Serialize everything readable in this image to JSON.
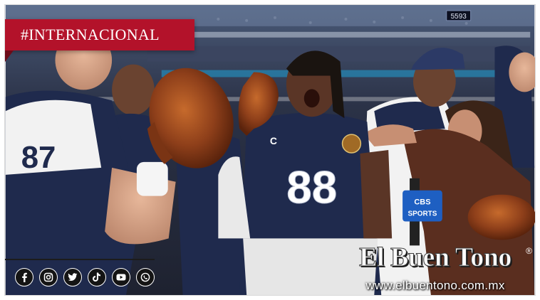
{
  "tag": {
    "label": "#INTERNACIONAL"
  },
  "scene": {
    "jersey_number_left": "87",
    "jersey_number_center": "88",
    "patch_letter": "C",
    "mic_flag_line1": "CBS",
    "mic_flag_line2": "SPORTS",
    "scoreboard_number": "5593"
  },
  "social": {
    "icons": [
      "facebook-icon",
      "instagram-icon",
      "twitter-icon",
      "tiktok-icon",
      "youtube-icon",
      "whatsapp-icon"
    ]
  },
  "brand": {
    "logo_text": "El Buen Tono",
    "registered_mark": "®",
    "url": "www.elbuentono.com.mx"
  },
  "colors": {
    "tag_red": "#b3122a",
    "jersey_navy": "#1f2a4d",
    "jersey_white": "#f2f2f2",
    "turkey_brown": "#8e3f1a"
  }
}
